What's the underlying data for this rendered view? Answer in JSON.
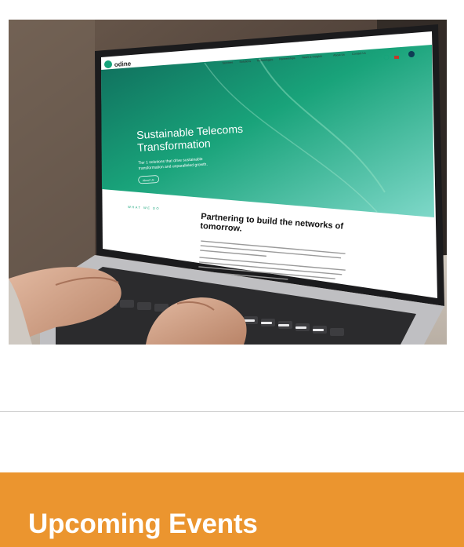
{
  "hero_photo": {
    "alt_subject": "laptop-with-website",
    "site": {
      "logo_text": "odine",
      "nav": [
        "Services",
        "Solutions",
        "Technologies",
        "Partnerships",
        "News & Insights",
        "About Us",
        "Contact Us"
      ],
      "hero_heading_line1": "Sustainable Telecoms",
      "hero_heading_line2": "Transformation",
      "hero_sub_line1": "Tier 1 solutions that drive sustainable",
      "hero_sub_line2": "transformation and unparalleled growth.",
      "hero_button": "About Us",
      "section_eyebrow": "WHAT WE DO",
      "section_heading_line1": "Partnering to build the networks of",
      "section_heading_line2": "tomorrow."
    }
  },
  "events": {
    "title": "Upcoming Events",
    "background": "#eb952f"
  }
}
